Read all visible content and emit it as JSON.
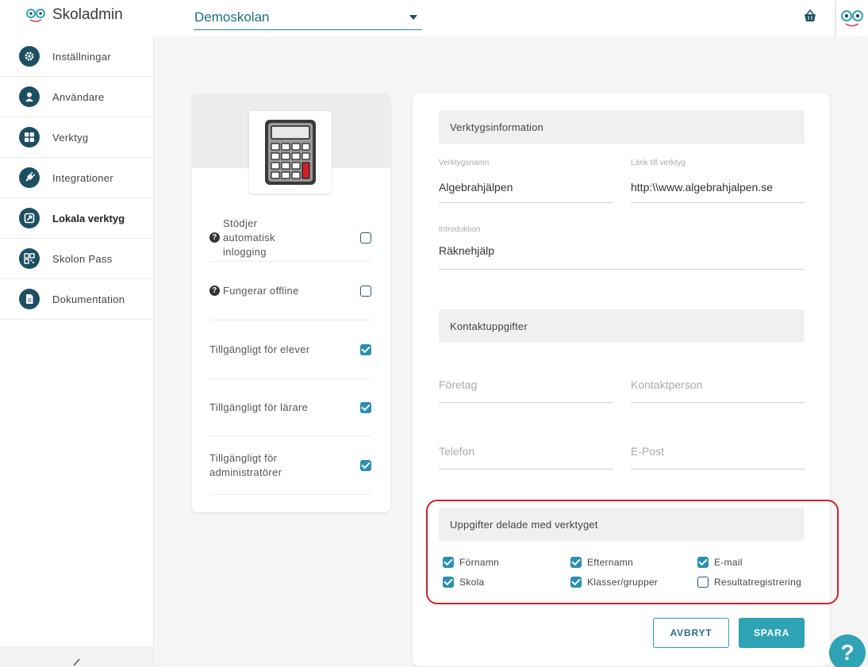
{
  "header": {
    "app_name": "Skoladmin",
    "school_select": {
      "value": "Demoskolan"
    },
    "icons": [
      "skolon-logo-icon",
      "basket-icon",
      "user-avatar-icon"
    ]
  },
  "sidebar": {
    "items": [
      {
        "label": "Inställningar",
        "icon": "gear-icon",
        "active": false
      },
      {
        "label": "Användare",
        "icon": "user-icon",
        "active": false
      },
      {
        "label": "Verktyg",
        "icon": "grid-icon",
        "active": false
      },
      {
        "label": "Integrationer",
        "icon": "plug-icon",
        "active": false
      },
      {
        "label": "Lokala verktyg",
        "icon": "arrow-out-icon",
        "active": true
      },
      {
        "label": "Skolon Pass",
        "icon": "qr-icon",
        "active": false
      },
      {
        "label": "Dokumentation",
        "icon": "document-icon",
        "active": false
      }
    ]
  },
  "tool_card": {
    "image_icon": "calculator-icon",
    "options": [
      {
        "label": "Stödjer automatisk inlogging",
        "help": true,
        "checked": false
      },
      {
        "label": "Fungerar offline",
        "help": true,
        "checked": false
      },
      {
        "label": "Tillgängligt för elever",
        "help": false,
        "checked": true
      },
      {
        "label": "Tillgängligt för lärare",
        "help": false,
        "checked": true
      },
      {
        "label": "Tillgängligt för administratörer",
        "help": false,
        "checked": true
      }
    ]
  },
  "form": {
    "tool_info": {
      "heading": "Verktygsinformation",
      "name_label": "Verktygsnamn",
      "name_value": "Algebrahjälpen",
      "link_label": "Länk till verktyg",
      "link_value": "http:\\\\www.algebrahjalpen.se",
      "intro_label": "Introduktion",
      "intro_value": "Räknehjälp"
    },
    "contact": {
      "heading": "Kontaktuppgifter",
      "company_placeholder": "Företag",
      "person_placeholder": "Kontaktperson",
      "phone_placeholder": "Telefon",
      "email_placeholder": "E-Post"
    },
    "shared": {
      "heading": "Uppgifter delade med verktyget",
      "items": [
        {
          "label": "Förnamn",
          "checked": true
        },
        {
          "label": "Efternamn",
          "checked": true
        },
        {
          "label": "E-mail",
          "checked": true
        },
        {
          "label": "Skola",
          "checked": true
        },
        {
          "label": "Klasser/grupper",
          "checked": true
        },
        {
          "label": "Resultatregistrering",
          "checked": false
        }
      ]
    },
    "buttons": {
      "cancel": "AVBRYT",
      "save": "SPARA"
    }
  },
  "help_fab": "?",
  "colors": {
    "accent": "#2ea3b5",
    "nav_icon": "#1d4f63",
    "checkbox": "#2b8fb3",
    "highlight": "#d0202a"
  }
}
